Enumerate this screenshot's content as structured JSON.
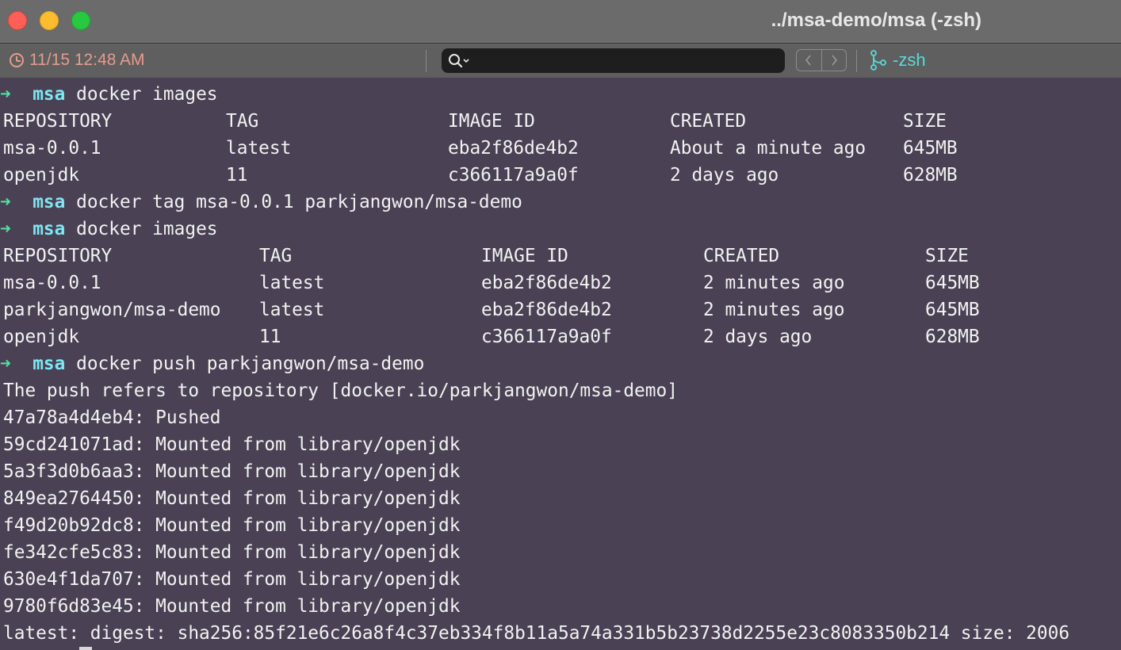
{
  "window": {
    "title": "../msa-demo/msa (-zsh)"
  },
  "statusbar": {
    "clock": "11/15 12:48 AM",
    "branch": "-zsh"
  },
  "colors": {
    "background": "#4a4154",
    "prompt_arrow": "#4fe39a",
    "prompt_dir": "#7fe6f2",
    "clock": "#e79a8e",
    "branch": "#5fd7d7"
  },
  "terminal": {
    "prompt_arrow": "➜",
    "prompt_dir": "msa",
    "cmd1": "docker images",
    "table1": {
      "headers": [
        "REPOSITORY",
        "TAG",
        "IMAGE ID",
        "CREATED",
        "SIZE"
      ],
      "rows": [
        [
          "msa-0.0.1",
          "latest",
          "eba2f86de4b2",
          "About a minute ago",
          "645MB"
        ],
        [
          "openjdk",
          "11",
          "c366117a9a0f",
          "2 days ago",
          "628MB"
        ]
      ]
    },
    "cmd2": "docker tag msa-0.0.1 parkjangwon/msa-demo",
    "cmd3": "docker images",
    "table2": {
      "headers": [
        "REPOSITORY",
        "TAG",
        "IMAGE ID",
        "CREATED",
        "SIZE"
      ],
      "rows": [
        [
          "msa-0.0.1",
          "latest",
          "eba2f86de4b2",
          "2 minutes ago",
          "645MB"
        ],
        [
          "parkjangwon/msa-demo",
          "latest",
          "eba2f86de4b2",
          "2 minutes ago",
          "645MB"
        ],
        [
          "openjdk",
          "11",
          "c366117a9a0f",
          "2 days ago",
          "628MB"
        ]
      ]
    },
    "cmd4": "docker push parkjangwon/msa-demo",
    "push_output": [
      "The push refers to repository [docker.io/parkjangwon/msa-demo]",
      "47a78a4d4eb4: Pushed",
      "59cd241071ad: Mounted from library/openjdk",
      "5a3f3d0b6aa3: Mounted from library/openjdk",
      "849ea2764450: Mounted from library/openjdk",
      "f49d20b92dc8: Mounted from library/openjdk",
      "fe342cfe5c83: Mounted from library/openjdk",
      "630e4f1da707: Mounted from library/openjdk",
      "9780f6d83e45: Mounted from library/openjdk",
      "latest: digest: sha256:85f21e6c26a8f4c37eb334f8b11a5a74a331b5b23738d2255e23c8083350b214 size: 2006"
    ]
  }
}
